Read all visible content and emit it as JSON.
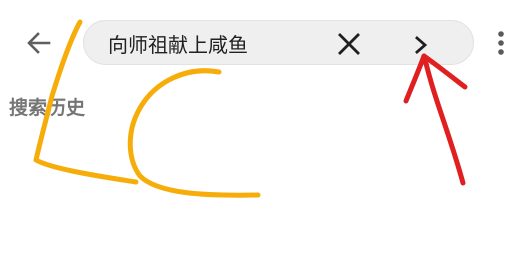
{
  "topbar": {
    "back_icon": "arrow-left-icon",
    "search": {
      "value": "向师祖献上咸鱼",
      "clear_icon": "close-icon",
      "go_icon": "chevron-right-icon"
    },
    "more_icon": "more-vert-icon"
  },
  "history": {
    "title": "搜索历史"
  },
  "annotations": {
    "handwriting_color": "#f6ad0a",
    "arrow_color": "#e02020"
  },
  "colors": {
    "icon": "#4a4a4a",
    "search_bg": "#efefef"
  }
}
